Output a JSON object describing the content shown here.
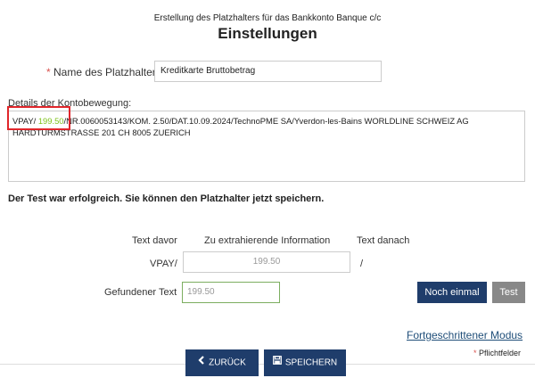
{
  "header": {
    "subtitle": "Erstellung des Platzhalters für das Bankkonto Banque c/c",
    "title": "Einstellungen"
  },
  "form": {
    "name_label": "Name des Platzhalters",
    "name_value": "Kreditkarte Bruttobetrag",
    "details_label": "Details der Kontobewegung:",
    "details_prefix": "VPAY/ ",
    "details_highlight": "199.50",
    "details_rest": "/NR.0060053143/KOM. 2.50/DAT.10.09.2024/TechnoPME SA/Yverdon-les-Bains WORLDLINE SCHWEIZ AG HARDTURMSTRASSE 201 CH 8005 ZUERICH"
  },
  "test": {
    "success_message": "Der Test war erfolgreich. Sie können den Platzhalter jetzt speichern.",
    "col_before": "Text davor",
    "col_extract": "Zu extrahierende Information",
    "col_after": "Text danach",
    "before_value": "VPAY/",
    "extract_value": "199.50",
    "after_value": "/",
    "found_label": "Gefundener Text",
    "found_value": "199.50",
    "again_button": "Noch einmal",
    "test_button": "Test"
  },
  "footer": {
    "advanced_link": "Fortgeschrittener Modus",
    "required_note": "Pflichtfelder",
    "back_button": "ZURÜCK",
    "save_button": "SPEICHERN"
  },
  "colors": {
    "primary": "#1f3d6b",
    "highlight": "#7ec21c",
    "required": "#d9534f",
    "annotation": "#e0262b"
  }
}
